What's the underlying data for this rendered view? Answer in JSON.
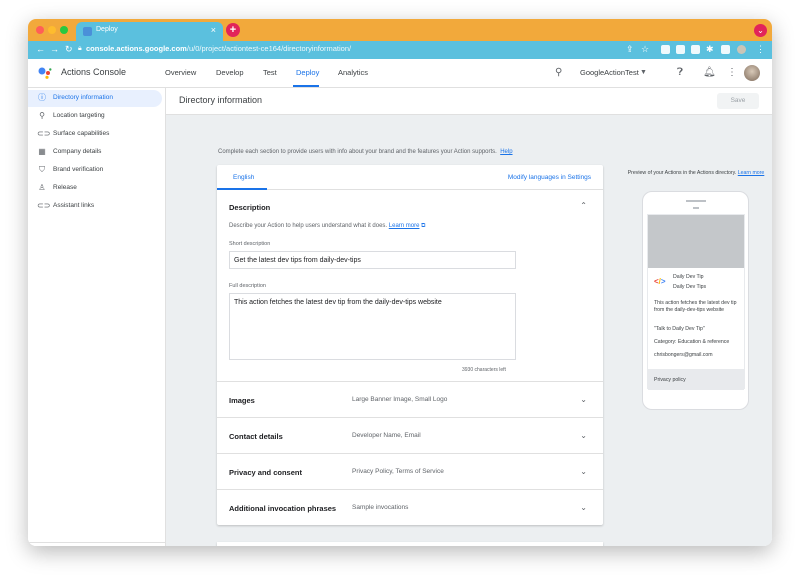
{
  "browser": {
    "tab_title": "Deploy",
    "tab_close": "×",
    "new_tab": "+",
    "url_host": "console.actions.google.com",
    "url_path": "/u/0/project/actiontest-ce164/directoryinformation/"
  },
  "app": {
    "name": "Actions Console",
    "nav": [
      "Overview",
      "Develop",
      "Test",
      "Deploy",
      "Analytics"
    ],
    "active_nav": "Deploy",
    "project": "GoogleActionTest"
  },
  "sidebar": {
    "items": [
      {
        "label": "Directory information",
        "icon": "info-icon"
      },
      {
        "label": "Location targeting",
        "icon": "location-pin-icon"
      },
      {
        "label": "Surface capabilities",
        "icon": "link-icon"
      },
      {
        "label": "Company details",
        "icon": "building-icon"
      },
      {
        "label": "Brand verification",
        "icon": "shield-icon"
      },
      {
        "label": "Release",
        "icon": "person-icon"
      },
      {
        "label": "Assistant links",
        "icon": "link-icon"
      }
    ],
    "collapse_label": "‹"
  },
  "page": {
    "title": "Directory information",
    "save_label": "Save"
  },
  "intro": {
    "text": "Complete each section to provide users with info about your brand and the features your Action supports.",
    "help": "Help"
  },
  "card": {
    "language_tab": "English",
    "modify_languages": "Modify languages in Settings",
    "description": {
      "title": "Description",
      "help_text": "Describe your Action to help users understand what it does.",
      "learn_more": "Learn more",
      "short_label": "Short description",
      "short_value": "Get the latest dev tips from daily-dev-tips",
      "full_label": "Full description",
      "full_value": "This action fetches the latest dev tip from the daily-dev-tips website",
      "counter": "3930 characters left"
    },
    "sections": [
      {
        "title": "Images",
        "summary": "Large Banner Image, Small Logo"
      },
      {
        "title": "Contact details",
        "summary": "Developer Name, Email"
      },
      {
        "title": "Privacy and consent",
        "summary": "Privacy Policy, Terms of Service"
      },
      {
        "title": "Additional invocation phrases",
        "summary": "Sample invocations"
      }
    ]
  },
  "preview": {
    "caption": "Preview of your Actions in the Actions directory.",
    "learn_more": "Learn more",
    "app_title": "Daily Dev Tip",
    "app_subtitle": "Daily Dev Tips",
    "description": "This action fetches the latest dev tip from the daily-dev-tips website",
    "invocation": "\"Talk to Daily Dev Tip\"",
    "category": "Category: Education & reference",
    "email": "chrisbongers@gmail.com",
    "privacy": "Privacy policy"
  },
  "colors": {
    "accent": "#1a73e8",
    "chrome_titlebar": "#f2a93b",
    "chrome_toolbar": "#5bc0de"
  }
}
